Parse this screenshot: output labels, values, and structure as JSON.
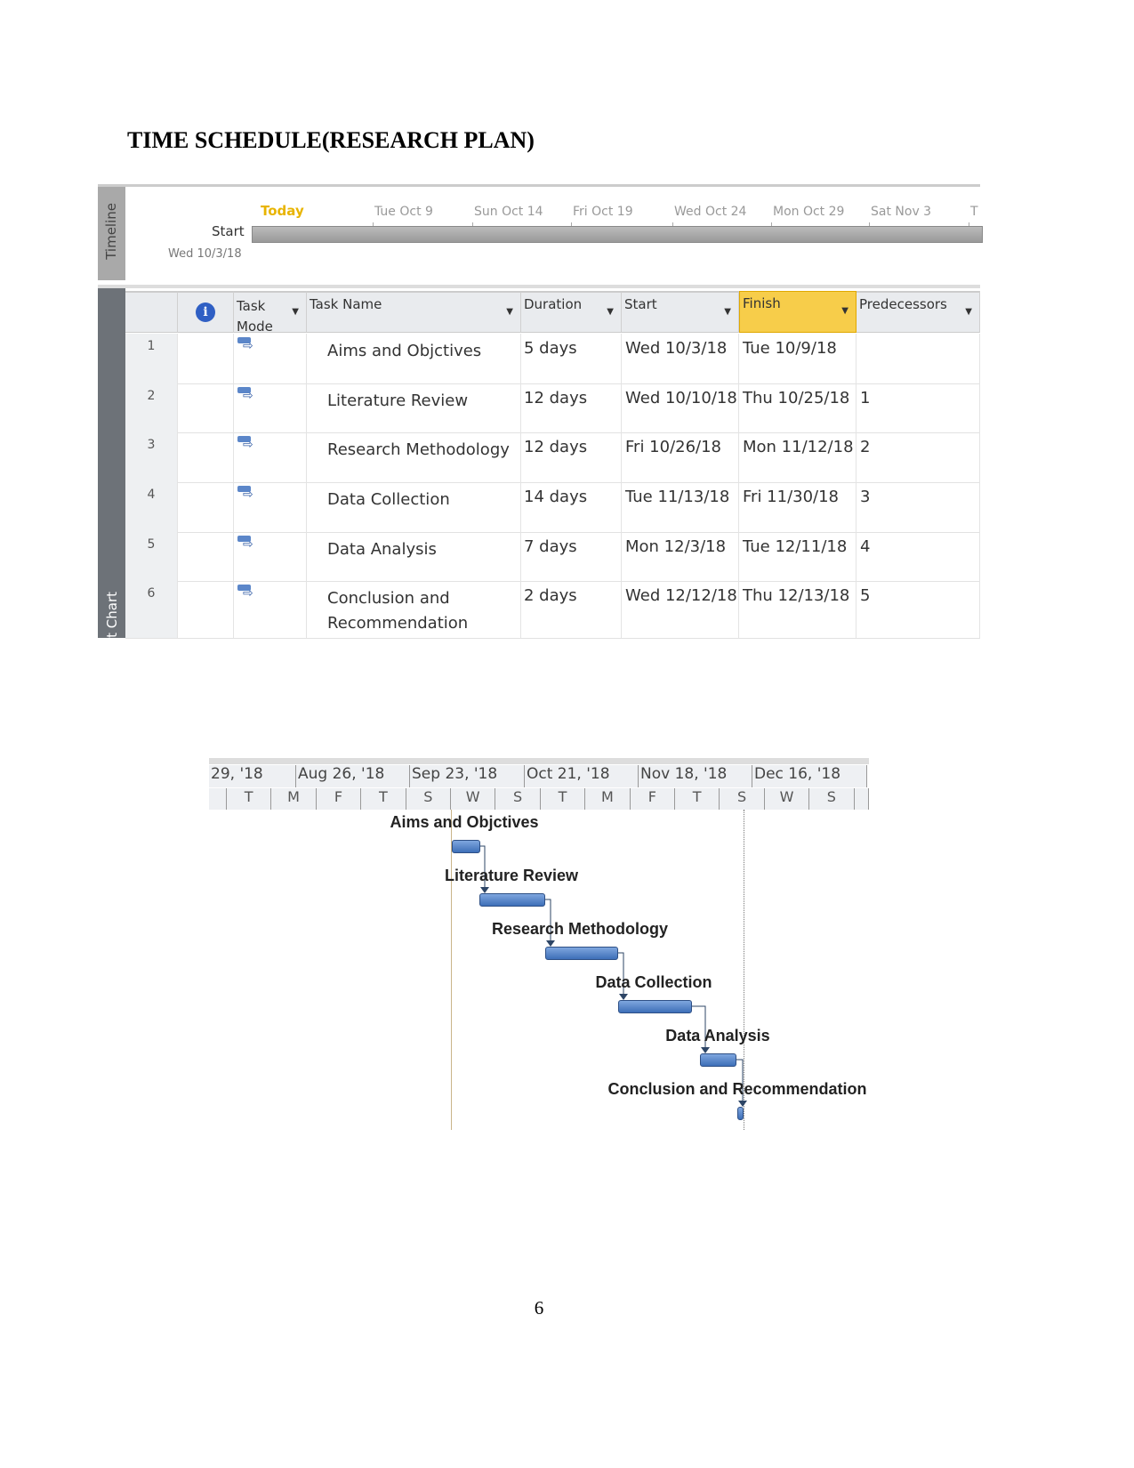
{
  "title": "TIME SCHEDULE(RESEARCH PLAN)",
  "page_number": "6",
  "timeline": {
    "side_label": "Timeline",
    "today": "Today",
    "dates": [
      "Tue Oct 9",
      "Sun Oct 14",
      "Fri Oct 19",
      "Wed Oct 24",
      "Mon Oct 29",
      "Sat Nov 3",
      "T"
    ],
    "start_label": "Start",
    "start_date": "Wed 10/3/18"
  },
  "grid": {
    "side_label": "t Chart",
    "headers": [
      "Task Mode",
      "Task Name",
      "Duration",
      "Start",
      "Finish",
      "Predecessors"
    ],
    "highlight_color": "#f5c842",
    "rows": [
      {
        "id": "1",
        "name": "Aims and Objctives",
        "duration": "5 days",
        "start": "Wed 10/3/18",
        "finish": "Tue 10/9/18",
        "pred": ""
      },
      {
        "id": "2",
        "name": "Literature Review",
        "duration": "12 days",
        "start": "Wed 10/10/18",
        "finish": "Thu 10/25/18",
        "pred": "1"
      },
      {
        "id": "3",
        "name": "Research Methodology",
        "duration": "12 days",
        "start": "Fri 10/26/18",
        "finish": "Mon 11/12/18",
        "pred": "2"
      },
      {
        "id": "4",
        "name": "Data Collection",
        "duration": "14 days",
        "start": "Tue 11/13/18",
        "finish": "Fri 11/30/18",
        "pred": "3"
      },
      {
        "id": "5",
        "name": "Data Analysis",
        "duration": "7 days",
        "start": "Mon 12/3/18",
        "finish": "Tue 12/11/18",
        "pred": "4"
      },
      {
        "id": "6",
        "name": "Conclusion and Recommendation",
        "duration": "2 days",
        "start": "Wed 12/12/18",
        "finish": "Thu 12/13/18",
        "pred": "5"
      }
    ]
  },
  "gantt": {
    "months": [
      "29, '18",
      "Aug 26, '18",
      "Sep 23, '18",
      "Oct 21, '18",
      "Nov 18, '18",
      "Dec 16, '18"
    ],
    "days": [
      "T",
      "M",
      "F",
      "T",
      "S",
      "W",
      "S",
      "T",
      "M",
      "F",
      "T",
      "S",
      "W",
      "S"
    ],
    "bar_color": "#4f81c7",
    "labels": [
      "Aims and Objctives",
      "Literature Review",
      "Research Methodology",
      "Data Collection",
      "Data Analysis",
      "Conclusion and Recommendation"
    ]
  }
}
